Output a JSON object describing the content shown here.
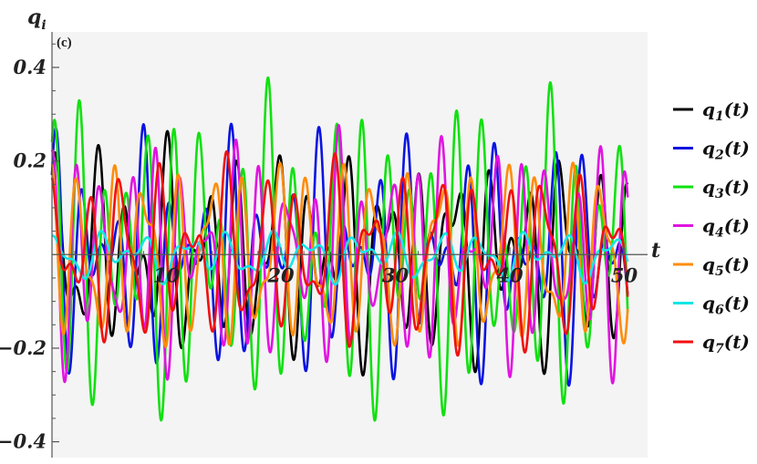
{
  "chart_data": {
    "type": "line",
    "panel_label": "(c)",
    "xlabel": "t",
    "ylabel_main": "q",
    "ylabel_sub": "i",
    "xlim": [
      0,
      51
    ],
    "ylim": [
      -0.43,
      0.47
    ],
    "x_ticks": [
      10,
      20,
      30,
      40,
      50
    ],
    "y_ticks": [
      -0.4,
      -0.2,
      0.2,
      0.4
    ],
    "x_tick_labels": [
      "10",
      "20",
      "30",
      "40",
      "50"
    ],
    "y_tick_labels": [
      "−0.4",
      "−0.2",
      "0.2",
      "0.4"
    ],
    "series": [
      {
        "id": "q1",
        "label_main": "q",
        "label_sub": "1",
        "label_tail": "(t)",
        "color": "#000000",
        "components": [
          [
            0.12,
            2.0,
            0.3
          ],
          [
            0.1,
            3.15,
            1.1
          ],
          [
            0.05,
            1.25,
            2.0
          ]
        ]
      },
      {
        "id": "q2",
        "label_main": "q",
        "label_sub": "2",
        "label_tail": "(t)",
        "color": "#0a14e0",
        "components": [
          [
            0.13,
            2.45,
            0.9
          ],
          [
            0.1,
            3.3,
            0.2
          ],
          [
            0.05,
            1.6,
            1.5
          ]
        ]
      },
      {
        "id": "q3",
        "label_main": "q",
        "label_sub": "3",
        "label_tail": "(t)",
        "color": "#11e011",
        "components": [
          [
            0.2,
            3.05,
            0.6
          ],
          [
            0.12,
            2.3,
            2.1
          ],
          [
            0.06,
            1.05,
            0.4
          ]
        ]
      },
      {
        "id": "q4",
        "label_main": "q",
        "label_sub": "4",
        "label_tail": "(t)",
        "color": "#e014e0",
        "components": [
          [
            0.14,
            2.75,
            1.8
          ],
          [
            0.09,
            3.55,
            0.7
          ],
          [
            0.05,
            1.45,
            2.6
          ]
        ]
      },
      {
        "id": "q5",
        "label_main": "q",
        "label_sub": "5",
        "label_tail": "(t)",
        "color": "#ff8c0a",
        "components": [
          [
            0.13,
            2.2,
            2.4
          ],
          [
            0.08,
            3.45,
            1.3
          ],
          [
            0.04,
            0.95,
            0.8
          ]
        ]
      },
      {
        "id": "q6",
        "label_main": "q",
        "label_sub": "6",
        "label_tail": "(t)",
        "color": "#14e6e6",
        "components": [
          [
            0.03,
            1.7,
            0.5
          ],
          [
            0.02,
            2.9,
            1.9
          ],
          [
            0.015,
            0.85,
            2.7
          ]
        ]
      },
      {
        "id": "q7",
        "label_main": "q",
        "label_sub": "7",
        "label_tail": "(t)",
        "color": "#f01010",
        "components": [
          [
            0.12,
            2.05,
            1.4
          ],
          [
            0.07,
            3.25,
            2.5
          ],
          [
            0.04,
            1.35,
            0.1
          ]
        ]
      }
    ]
  }
}
